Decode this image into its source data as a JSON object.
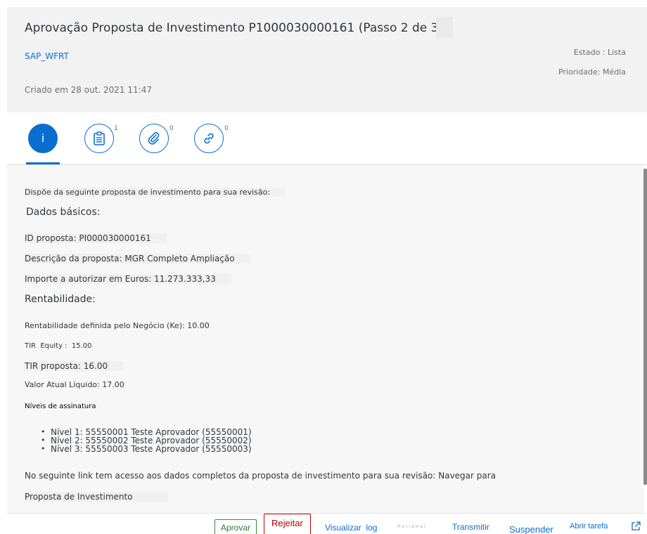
{
  "header": {
    "title": "Aprovação Proposta de Investimento P1000030000161 (Passo 2 de 3)",
    "created_by": "SAP_WFRT",
    "created_on": "Criado em 28 out. 2021 11:47",
    "status": "Estado : Lista",
    "priority": "Prioridade: Média"
  },
  "tabs": [
    {
      "name": "info",
      "icon": "info-icon",
      "count": ""
    },
    {
      "name": "notes",
      "icon": "notes-icon",
      "count": "1"
    },
    {
      "name": "attachments",
      "icon": "paperclip-icon",
      "count": "0"
    },
    {
      "name": "links",
      "icon": "link-icon",
      "count": "0"
    }
  ],
  "content": {
    "intro": "Dispõe da seguinte proposta de investimento para sua revisão:",
    "basic_heading": "Dados básicos:",
    "proposal_id": "ID proposta: PI000030000161",
    "proposal_desc": "Descrição da proposta: MGR Completo Ampliação",
    "amount": "Importe a autorizar em Euros: 11.273.333,33",
    "profit_heading": "Rentabilidade:",
    "ke": "Rentabilidade definida pelo Negócio (Ke): 10.00",
    "tir_equity": "TIR  Equity :  15.00",
    "tir_proposal": "TIR proposta: 16.00",
    "npv": "Valor Atual Líquido: 17.00",
    "levels_heading": "Níveis de assinatura",
    "levels": [
      "Nível 1: 55550001 Teste Aprovador (55550001)",
      "Nível 2: 55550002 Teste Aprovador (55550002)",
      "Nível 3: 55550003 Teste Aprovador (55550003)"
    ],
    "link_text": "No seguinte link tem acesso aos dados completos da proposta de investimento para sua revisão: Navegar para",
    "link_target": "Proposta de Investimento"
  },
  "footer": {
    "approve": "Aprovar",
    "reject": "Rejeitar",
    "view_log": "Visualizar  log",
    "claim": "Reclamar",
    "forward": "Transmitir",
    "suspend": "Suspender",
    "open_task": "Abrir tarefa"
  },
  "colors": {
    "accent": "#0a6ed1",
    "approve": "#2b7c2b",
    "reject": "#bb0000"
  }
}
